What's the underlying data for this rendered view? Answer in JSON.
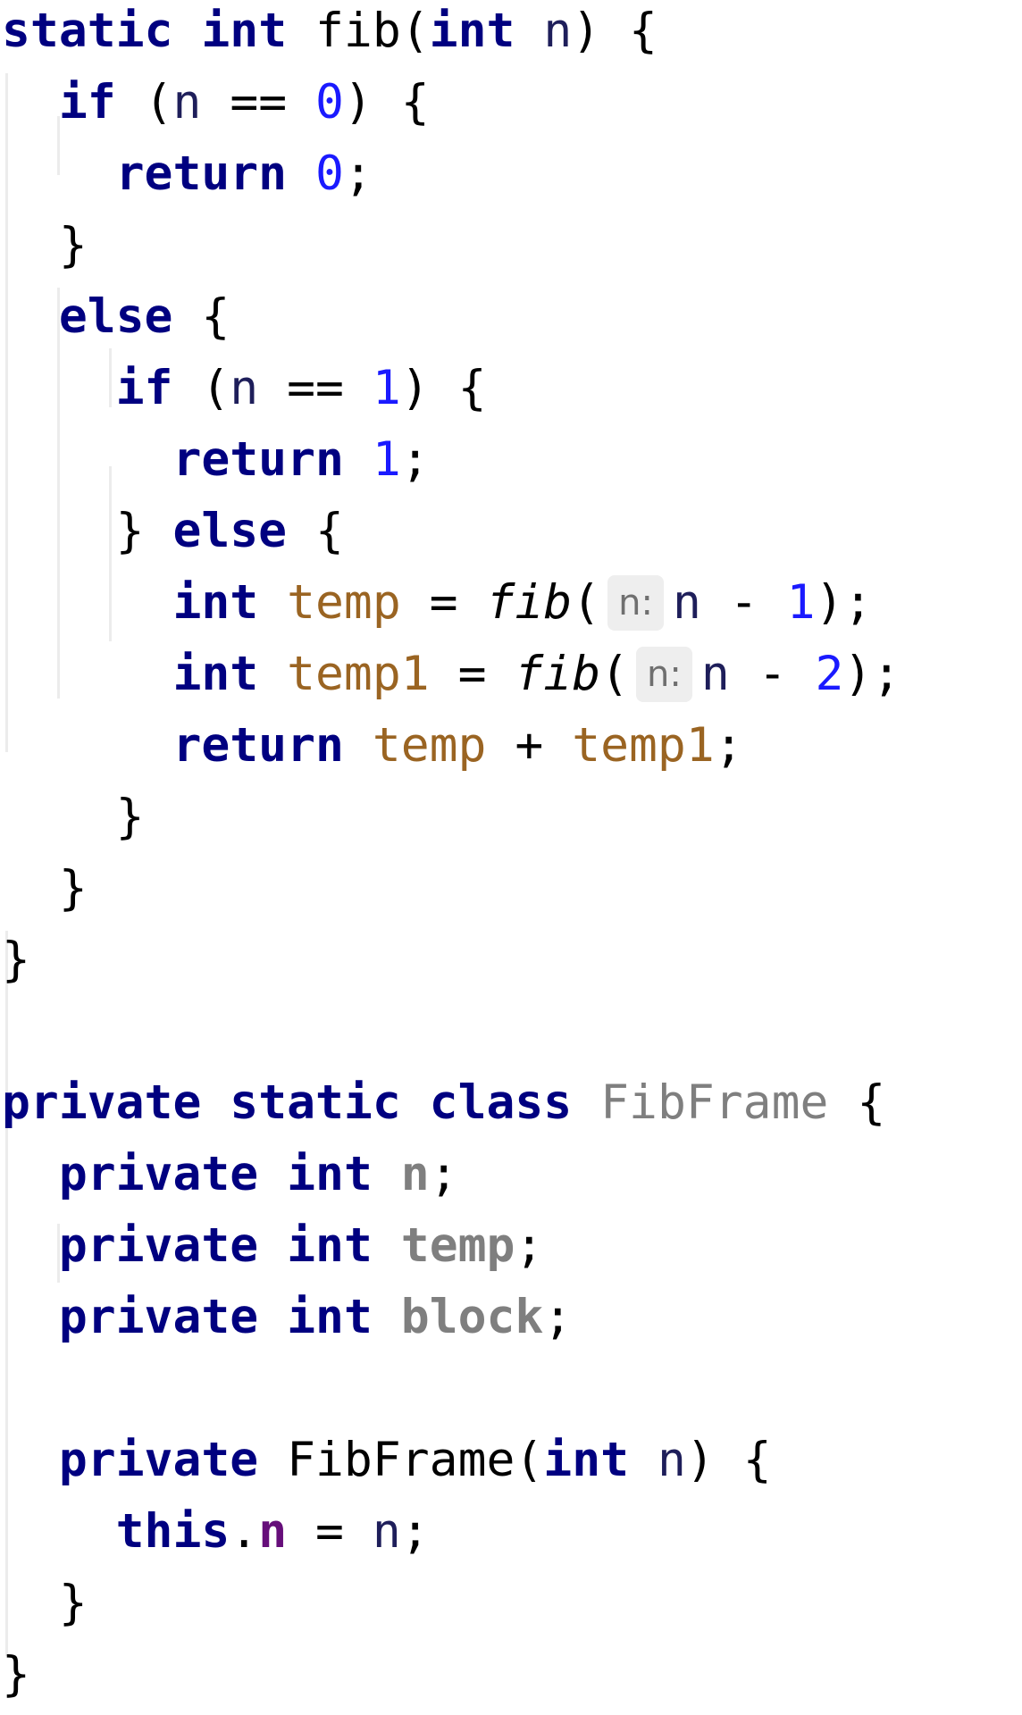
{
  "editor": {
    "lines": [
      [
        {
          "t": "static",
          "c": "kw"
        },
        {
          "t": " "
        },
        {
          "t": "int",
          "c": "kw"
        },
        {
          "t": " fib("
        },
        {
          "t": "int",
          "c": "kw"
        },
        {
          "t": " "
        },
        {
          "t": "n",
          "c": "param"
        },
        {
          "t": ") {"
        }
      ],
      [
        {
          "t": "  "
        },
        {
          "t": "if",
          "c": "kw"
        },
        {
          "t": " ("
        },
        {
          "t": "n",
          "c": "param"
        },
        {
          "t": " == "
        },
        {
          "t": "0",
          "c": "num"
        },
        {
          "t": ") {"
        }
      ],
      [
        {
          "t": "    "
        },
        {
          "t": "return",
          "c": "kw"
        },
        {
          "t": " "
        },
        {
          "t": "0",
          "c": "num"
        },
        {
          "t": ";"
        }
      ],
      [
        {
          "t": "  }"
        }
      ],
      [
        {
          "t": "  "
        },
        {
          "t": "else",
          "c": "kw"
        },
        {
          "t": " {"
        }
      ],
      [
        {
          "t": "    "
        },
        {
          "t": "if",
          "c": "kw"
        },
        {
          "t": " ("
        },
        {
          "t": "n",
          "c": "param"
        },
        {
          "t": " == "
        },
        {
          "t": "1",
          "c": "num"
        },
        {
          "t": ") {"
        }
      ],
      [
        {
          "t": "      "
        },
        {
          "t": "return",
          "c": "kw"
        },
        {
          "t": " "
        },
        {
          "t": "1",
          "c": "num"
        },
        {
          "t": ";"
        }
      ],
      [
        {
          "t": "    } "
        },
        {
          "t": "else",
          "c": "kw"
        },
        {
          "t": " {"
        }
      ],
      [
        {
          "t": "      "
        },
        {
          "t": "int",
          "c": "kw"
        },
        {
          "t": " "
        },
        {
          "t": "temp",
          "c": "local"
        },
        {
          "t": " = "
        },
        {
          "t": "fib",
          "c": "italic"
        },
        {
          "t": "("
        },
        {
          "hint": "n:"
        },
        {
          "t": "n",
          "c": "param"
        },
        {
          "t": " - "
        },
        {
          "t": "1",
          "c": "num"
        },
        {
          "t": ");"
        }
      ],
      [
        {
          "t": "      "
        },
        {
          "t": "int",
          "c": "kw"
        },
        {
          "t": " "
        },
        {
          "t": "temp1",
          "c": "local"
        },
        {
          "t": " = "
        },
        {
          "t": "fib",
          "c": "italic"
        },
        {
          "t": "("
        },
        {
          "hint": "n:"
        },
        {
          "t": "n",
          "c": "param"
        },
        {
          "t": " - "
        },
        {
          "t": "2",
          "c": "num"
        },
        {
          "t": ");"
        }
      ],
      [
        {
          "t": "      "
        },
        {
          "t": "return",
          "c": "kw"
        },
        {
          "t": " "
        },
        {
          "t": "temp",
          "c": "local"
        },
        {
          "t": " + "
        },
        {
          "t": "temp1",
          "c": "local"
        },
        {
          "t": ";"
        }
      ],
      [
        {
          "t": "    }"
        }
      ],
      [
        {
          "t": "  }"
        }
      ],
      [
        {
          "t": "}"
        }
      ],
      [],
      [
        {
          "t": "private",
          "c": "kw"
        },
        {
          "t": " "
        },
        {
          "t": "static",
          "c": "kw"
        },
        {
          "t": " "
        },
        {
          "t": "class",
          "c": "kw"
        },
        {
          "t": " "
        },
        {
          "t": "FibFrame",
          "c": "cls"
        },
        {
          "t": " {"
        }
      ],
      [
        {
          "t": "  "
        },
        {
          "t": "private",
          "c": "kw"
        },
        {
          "t": " "
        },
        {
          "t": "int",
          "c": "kw"
        },
        {
          "t": " "
        },
        {
          "t": "n",
          "c": "field"
        },
        {
          "t": ";"
        }
      ],
      [
        {
          "t": "  "
        },
        {
          "t": "private",
          "c": "kw"
        },
        {
          "t": " "
        },
        {
          "t": "int",
          "c": "kw"
        },
        {
          "t": " "
        },
        {
          "t": "temp",
          "c": "field"
        },
        {
          "t": ";"
        }
      ],
      [
        {
          "t": "  "
        },
        {
          "t": "private",
          "c": "kw"
        },
        {
          "t": " "
        },
        {
          "t": "int",
          "c": "kw"
        },
        {
          "t": " "
        },
        {
          "t": "block",
          "c": "field"
        },
        {
          "t": ";"
        }
      ],
      [],
      [
        {
          "t": "  "
        },
        {
          "t": "private",
          "c": "kw"
        },
        {
          "t": " FibFrame("
        },
        {
          "t": "int",
          "c": "kw"
        },
        {
          "t": " "
        },
        {
          "t": "n",
          "c": "param"
        },
        {
          "t": ") {"
        }
      ],
      [
        {
          "t": "    "
        },
        {
          "t": "this",
          "c": "kw"
        },
        {
          "t": "."
        },
        {
          "t": "n",
          "c": "fieldp"
        },
        {
          "t": " = "
        },
        {
          "t": "n",
          "c": "param"
        },
        {
          "t": ";"
        }
      ],
      [
        {
          "t": "  }"
        }
      ],
      [
        {
          "t": "}"
        }
      ]
    ]
  }
}
